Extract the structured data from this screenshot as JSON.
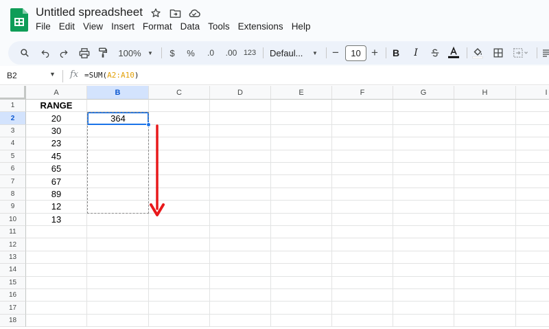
{
  "app": {
    "doc_title": "Untitled spreadsheet",
    "brand_color": "#0f9d58"
  },
  "menu": [
    "File",
    "Edit",
    "View",
    "Insert",
    "Format",
    "Data",
    "Tools",
    "Extensions",
    "Help"
  ],
  "toolbar": {
    "zoom": "100%",
    "currency": "$",
    "percent": "%",
    "decrease_decimal": ".0",
    "increase_decimal": ".00",
    "number_format": "123",
    "font": "Defaul...",
    "font_size": "10",
    "minus": "−",
    "plus": "+",
    "bold": "B",
    "italic": "I"
  },
  "formula_bar": {
    "cell_ref": "B2",
    "fx": "fx",
    "formula_prefix": "=SUM(",
    "formula_range": "A2:A10",
    "formula_suffix": ")"
  },
  "columns": [
    "A",
    "B",
    "C",
    "D",
    "E",
    "F",
    "G",
    "H",
    "I"
  ],
  "rows": [
    "1",
    "2",
    "3",
    "4",
    "5",
    "6",
    "7",
    "8",
    "9",
    "10",
    "11",
    "12",
    "13",
    "14",
    "15",
    "16",
    "17",
    "18"
  ],
  "cells": {
    "A1": "RANGE",
    "A2": "20",
    "A3": "30",
    "A4": "23",
    "A5": "45",
    "A6": "65",
    "A7": "67",
    "A8": "89",
    "A9": "12",
    "A10": "13",
    "B2": "364"
  },
  "selection": {
    "active_cell": "B2",
    "active_column": "B",
    "active_row": "2"
  },
  "annotation": {
    "arrow_color": "#e8191b"
  }
}
